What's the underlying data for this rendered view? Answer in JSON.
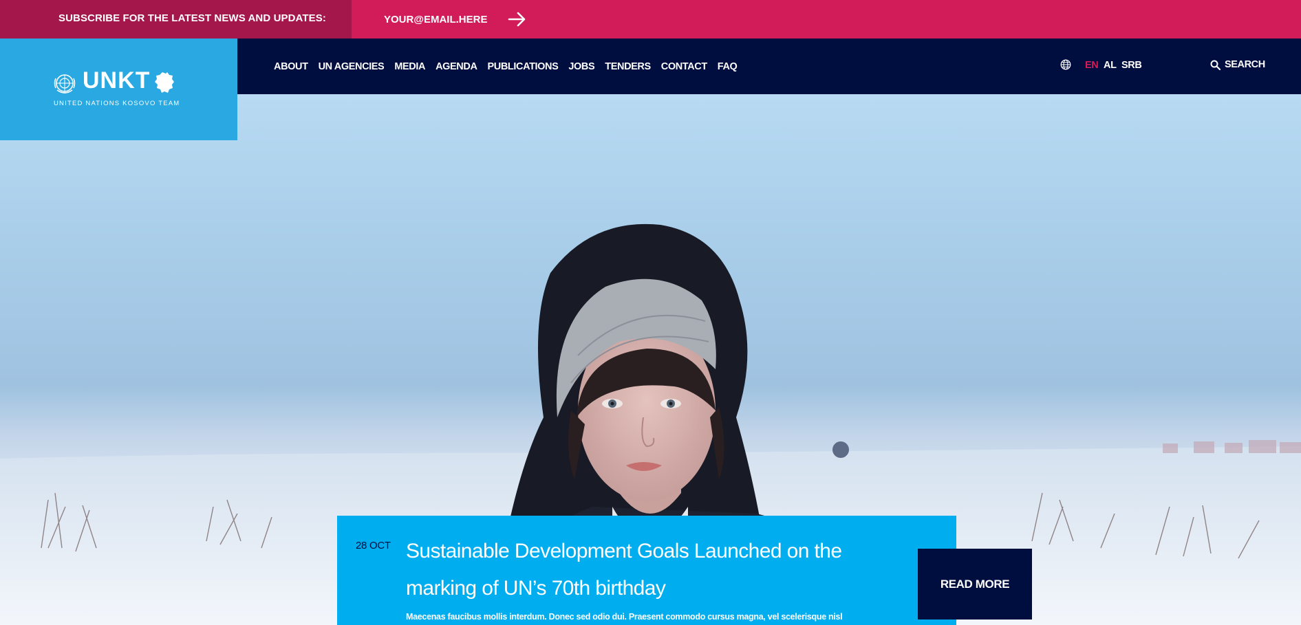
{
  "subscribe": {
    "label": "SUBSCRIBE FOR THE LATEST NEWS AND UPDATES:",
    "email_placeholder": "YOUR@EMAIL.HERE",
    "submit_icon": "arrow-right-icon"
  },
  "logo": {
    "title": "UNKT",
    "subtitle": "UNITED NATIONS KOSOVO TEAM",
    "emblem_icon": "un-emblem-icon",
    "map_icon": "kosovo-map-icon"
  },
  "nav": {
    "items": [
      {
        "label": "ABOUT"
      },
      {
        "label": "UN AGENCIES"
      },
      {
        "label": "MEDIA"
      },
      {
        "label": "AGENDA"
      },
      {
        "label": "PUBLICATIONS"
      },
      {
        "label": "JOBS"
      },
      {
        "label": "TENDERS"
      },
      {
        "label": "CONTACT"
      },
      {
        "label": "FAQ"
      }
    ]
  },
  "languages": {
    "icon": "globe-icon",
    "items": [
      {
        "code": "EN",
        "active": true
      },
      {
        "code": "AL",
        "active": false
      },
      {
        "code": "SRB",
        "active": false
      }
    ]
  },
  "search": {
    "label": "SEARCH",
    "icon": "search-icon"
  },
  "featured": {
    "date": "28 OCT",
    "title": "Sustainable Development Goals Launched on the marking of UN’s 70th birthday",
    "excerpt": "Maecenas faucibus mollis interdum. Donec sed odio dui. Praesent commodo cursus magna, vel scelerisque nisl",
    "read_more": "READ MORE"
  },
  "colors": {
    "subscribe_bar": "#d21c59",
    "subscribe_label_bg": "#a4174a",
    "navbar": "#000d3f",
    "logo_bg": "#29a8e1",
    "card_bg": "#00adef",
    "active_lang": "#d21c59"
  }
}
